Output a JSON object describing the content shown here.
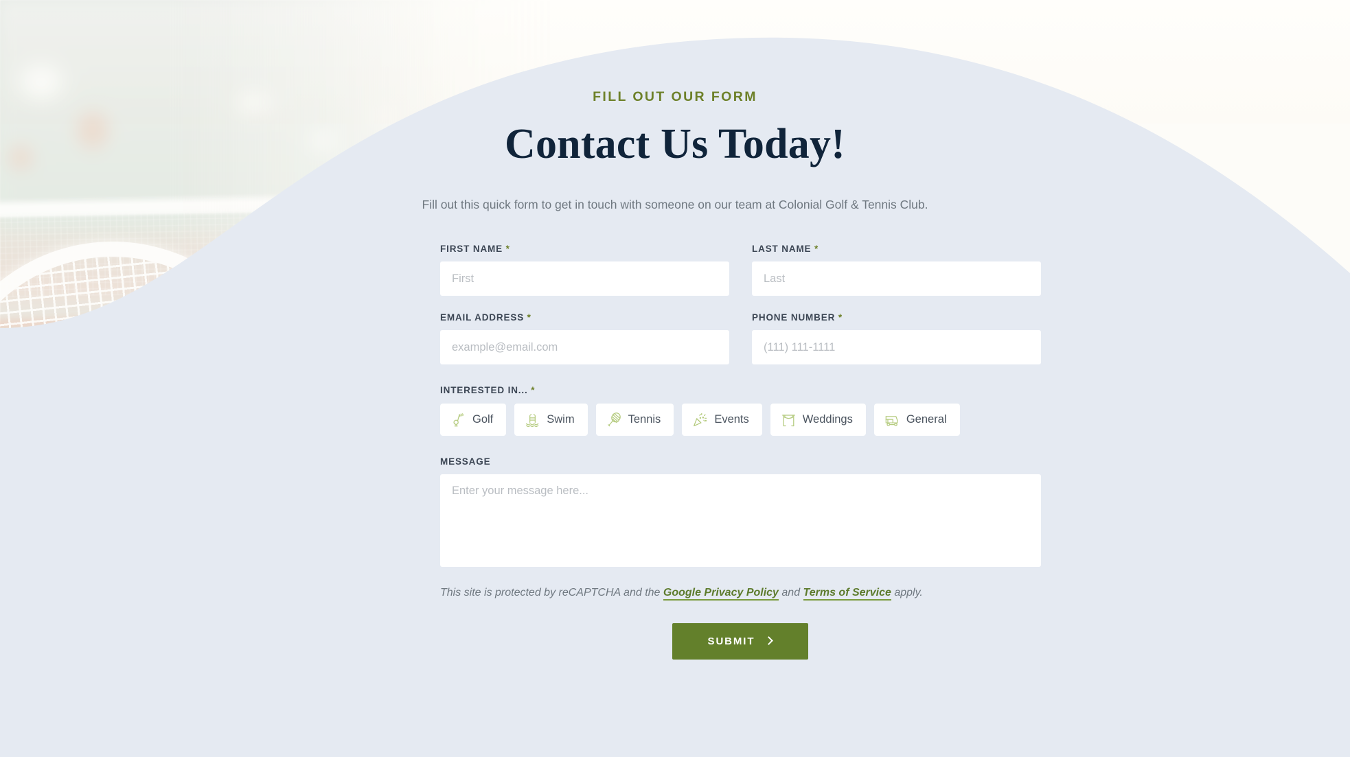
{
  "section": {
    "eyebrow": "FILL OUT OUR FORM",
    "headline": "Contact Us Today!",
    "subtext": "Fill out this quick form to get in touch with someone on our team at Colonial Golf & Tennis Club."
  },
  "colors": {
    "accent_green": "#6d8029",
    "button_green": "#63802b",
    "headline_navy": "#10243a",
    "panel_blue": "#e5eaf2",
    "band_cream": "#fdfbf6",
    "icon_green": "#b5cb7f",
    "label_gray": "#3c4654",
    "placeholder_gray": "#b9bdc2"
  },
  "form": {
    "fields": {
      "first_name": {
        "label": "FIRST NAME",
        "required_mark": "*",
        "placeholder": "First",
        "value": ""
      },
      "last_name": {
        "label": "LAST NAME",
        "required_mark": "*",
        "placeholder": "Last",
        "value": ""
      },
      "email": {
        "label": "EMAIL ADDRESS",
        "required_mark": "*",
        "placeholder": "example@email.com",
        "value": ""
      },
      "phone": {
        "label": "PHONE NUMBER",
        "required_mark": "*",
        "placeholder": "(111) 111-1111",
        "value": ""
      },
      "message": {
        "label": "MESSAGE",
        "required_mark": "",
        "placeholder": "Enter your message here...",
        "value": ""
      }
    },
    "interest": {
      "label": "INTERESTED IN...",
      "required_mark": "*",
      "options": [
        {
          "label": "Golf",
          "icon": "golf-icon",
          "selected": false
        },
        {
          "label": "Swim",
          "icon": "swim-icon",
          "selected": false
        },
        {
          "label": "Tennis",
          "icon": "tennis-icon",
          "selected": false
        },
        {
          "label": "Events",
          "icon": "events-icon",
          "selected": false
        },
        {
          "label": "Weddings",
          "icon": "weddings-icon",
          "selected": false
        },
        {
          "label": "General",
          "icon": "golf-cart-icon",
          "selected": false
        }
      ]
    },
    "recaptcha": {
      "lead": "This site is protected by reCAPTCHA and the ",
      "link_privacy": "Google Privacy Policy",
      "mid": " and ",
      "link_terms": "Terms of Service",
      "tail": " apply."
    },
    "submit": {
      "label": "SUBMIT",
      "icon": "chevron-right-icon"
    }
  }
}
